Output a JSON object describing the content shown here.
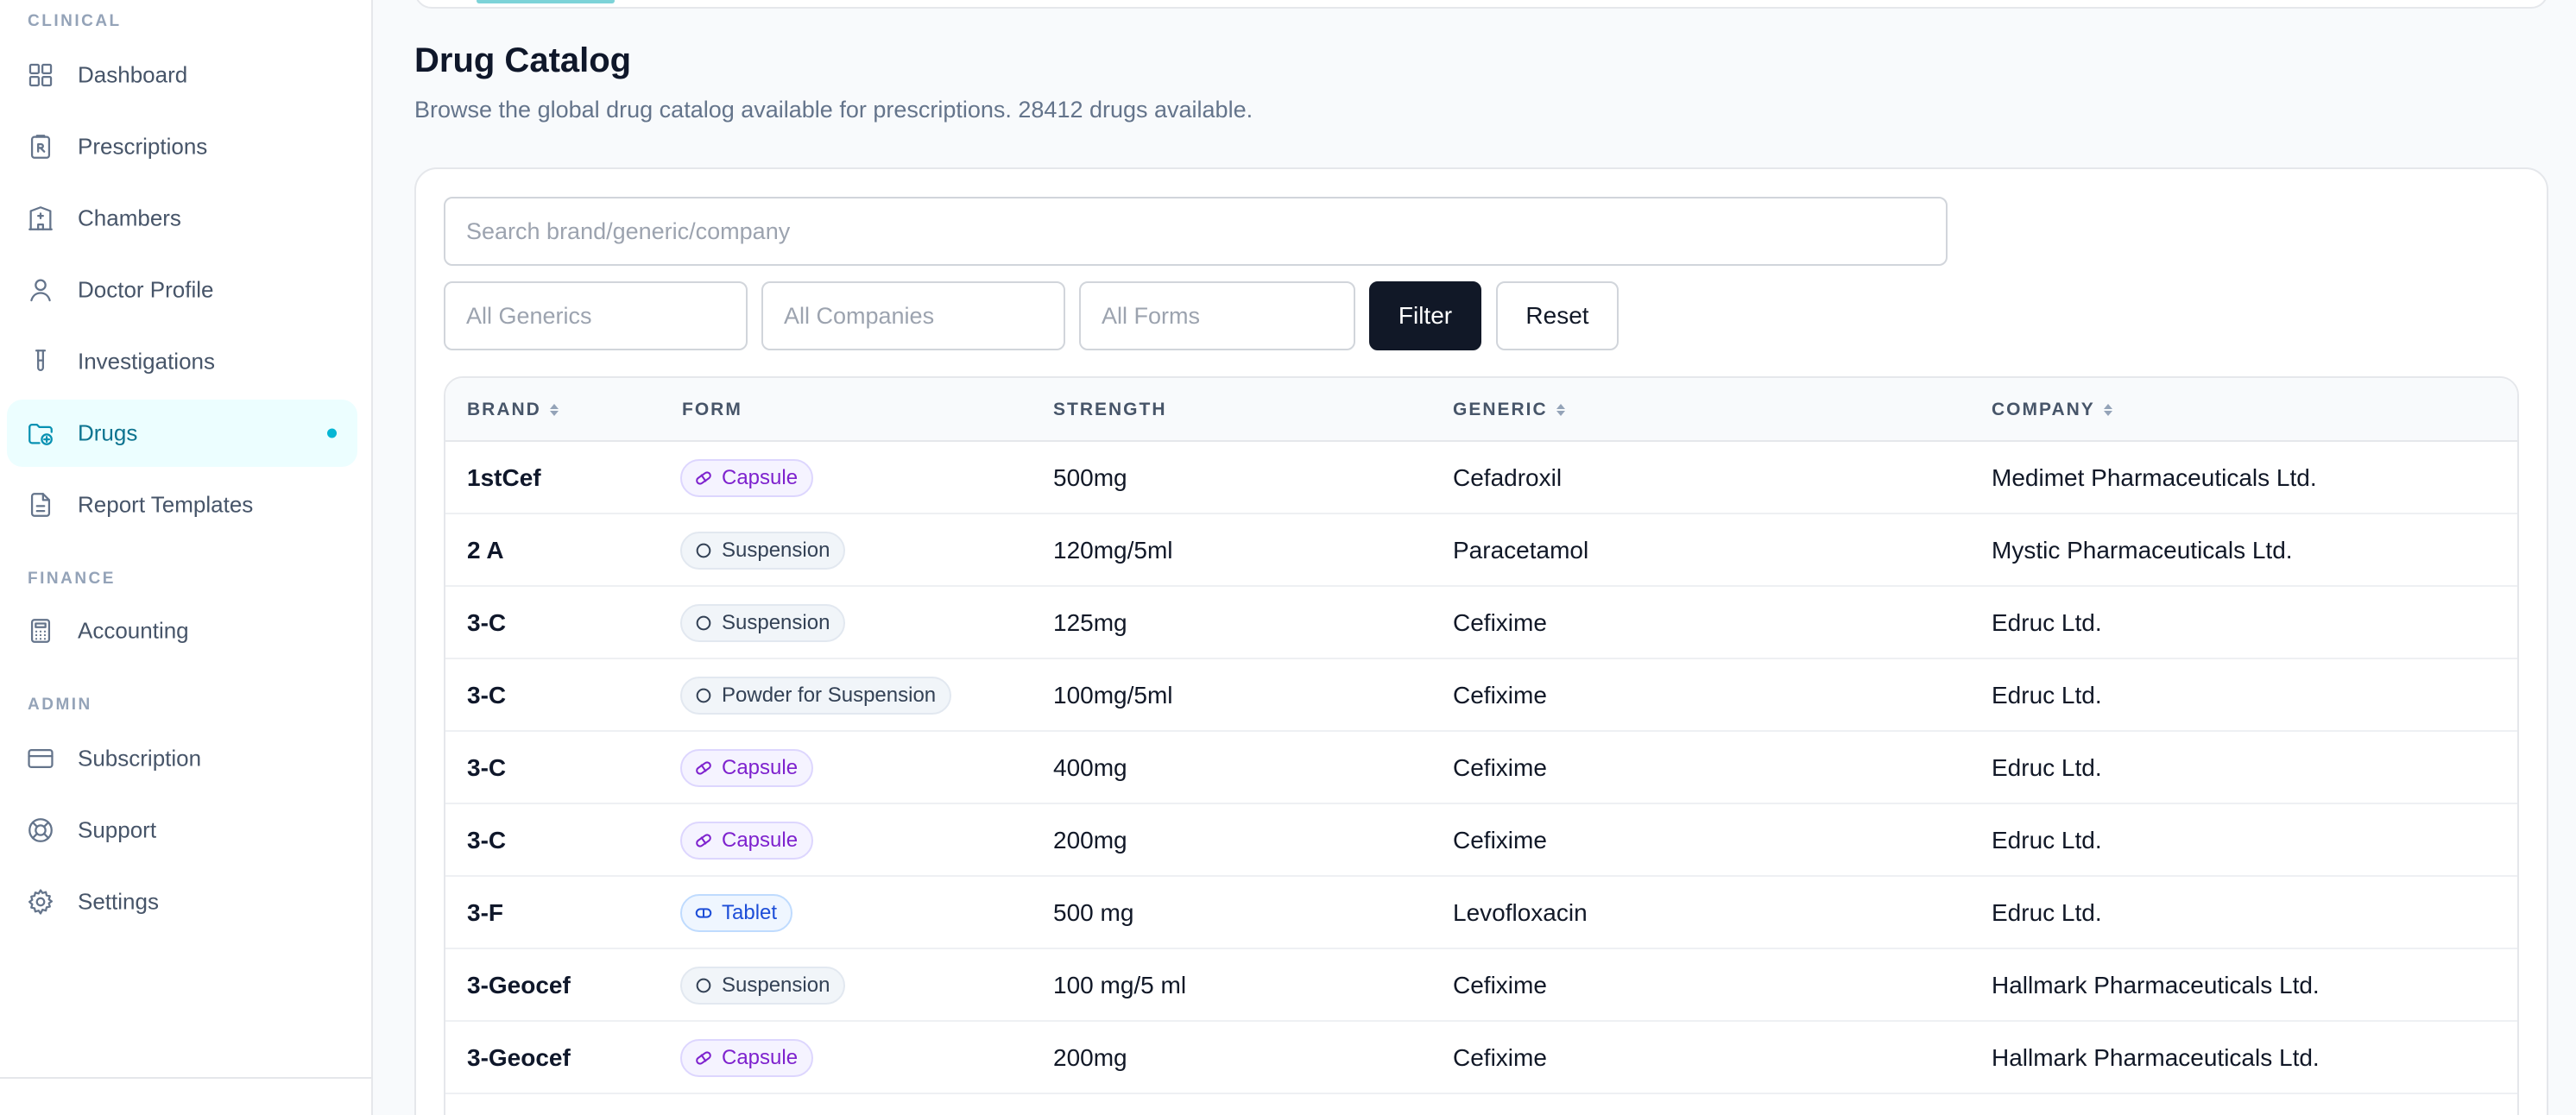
{
  "sidebar": {
    "sections": {
      "clinical": "CLINICAL",
      "finance": "FINANCE",
      "admin": "ADMIN"
    },
    "items": [
      {
        "label": "Dashboard",
        "icon": "grid-icon"
      },
      {
        "label": "Prescriptions",
        "icon": "clipboard-rx-icon"
      },
      {
        "label": "Chambers",
        "icon": "building-icon"
      },
      {
        "label": "Doctor Profile",
        "icon": "user-icon"
      },
      {
        "label": "Investigations",
        "icon": "test-tube-icon"
      },
      {
        "label": "Drugs",
        "icon": "folder-pill-icon",
        "active": true
      },
      {
        "label": "Report Templates",
        "icon": "document-icon"
      },
      {
        "label": "Accounting",
        "icon": "calculator-icon"
      },
      {
        "label": "Subscription",
        "icon": "credit-card-icon"
      },
      {
        "label": "Support",
        "icon": "lifebuoy-icon"
      },
      {
        "label": "Settings",
        "icon": "gear-icon"
      }
    ]
  },
  "page": {
    "title": "Drug Catalog",
    "subtitle": "Browse the global drug catalog available for prescriptions. 28412 drugs available."
  },
  "filters": {
    "search_placeholder": "Search brand/generic/company",
    "generics_placeholder": "All Generics",
    "companies_placeholder": "All Companies",
    "forms_placeholder": "All Forms",
    "filter_label": "Filter",
    "reset_label": "Reset"
  },
  "table": {
    "columns": {
      "brand": "BRAND",
      "form": "FORM",
      "strength": "STRENGTH",
      "generic": "GENERIC",
      "company": "COMPANY"
    },
    "rows": [
      {
        "brand": "1stCef",
        "form": "Capsule",
        "form_kind": "capsule",
        "strength": "500mg",
        "generic": "Cefadroxil",
        "company": "Medimet Pharmaceuticals Ltd."
      },
      {
        "brand": "2 A",
        "form": "Suspension",
        "form_kind": "suspension",
        "strength": "120mg/5ml",
        "generic": "Paracetamol",
        "company": "Mystic Pharmaceuticals Ltd."
      },
      {
        "brand": "3-C",
        "form": "Suspension",
        "form_kind": "suspension",
        "strength": "125mg",
        "generic": "Cefixime",
        "company": "Edruc Ltd."
      },
      {
        "brand": "3-C",
        "form": "Powder for Suspension",
        "form_kind": "suspension",
        "strength": "100mg/5ml",
        "generic": "Cefixime",
        "company": "Edruc Ltd."
      },
      {
        "brand": "3-C",
        "form": "Capsule",
        "form_kind": "capsule",
        "strength": "400mg",
        "generic": "Cefixime",
        "company": "Edruc Ltd."
      },
      {
        "brand": "3-C",
        "form": "Capsule",
        "form_kind": "capsule",
        "strength": "200mg",
        "generic": "Cefixime",
        "company": "Edruc Ltd."
      },
      {
        "brand": "3-F",
        "form": "Tablet",
        "form_kind": "tablet",
        "strength": "500 mg",
        "generic": "Levofloxacin",
        "company": "Edruc Ltd."
      },
      {
        "brand": "3-Geocef",
        "form": "Suspension",
        "form_kind": "suspension",
        "strength": "100 mg/5 ml",
        "generic": "Cefixime",
        "company": "Hallmark Pharmaceuticals Ltd."
      },
      {
        "brand": "3-Geocef",
        "form": "Capsule",
        "form_kind": "capsule",
        "strength": "200mg",
        "generic": "Cefixime",
        "company": "Hallmark Pharmaceuticals Ltd."
      }
    ]
  }
}
